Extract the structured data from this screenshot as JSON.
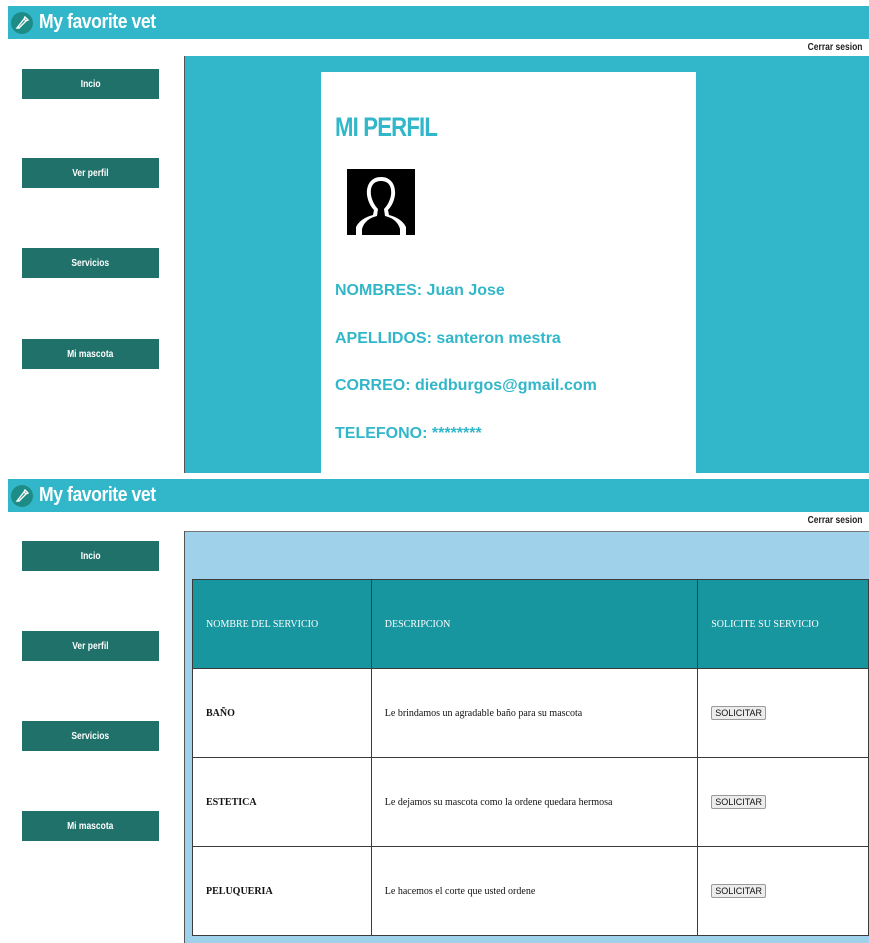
{
  "app": {
    "brand_title": "My favorite vet",
    "logout_label": "Cerrar sesion",
    "nav": [
      "Incio",
      "Ver perfil",
      "Servicios",
      "Mi mascota"
    ]
  },
  "profile_screen": {
    "title": "MI PERFIL",
    "fields": {
      "nombres": "NOMBRES: Juan Jose",
      "apellidos": "APELLIDOS: santeron mestra",
      "correo": "CORREO: diedburgos@gmail.com",
      "telefono": "TELEFONO: ********"
    }
  },
  "services_screen": {
    "columns": [
      "NOMBRE DEL SERVICIO",
      "DESCRIPCION",
      "SOLICITE SU SERVICIO"
    ],
    "rows": [
      {
        "name": "BAÑO",
        "description": "Le brindamos un agradable baño para su mascota",
        "action": "SOLICITAR"
      },
      {
        "name": "ESTETICA",
        "description": "Le dejamos su mascota como la ordene quedara hermosa",
        "action": "SOLICITAR"
      },
      {
        "name": "PELUQUERIA",
        "description": "Le hacemos el corte que usted ordene",
        "action": "SOLICITAR"
      }
    ]
  },
  "colors": {
    "header": "#31b7c9",
    "nav_button": "#1f716a",
    "table_header": "#1796a0",
    "services_background": "#9fd1ea"
  },
  "icons": {
    "logo": "pen-nib-icon",
    "avatar": "user-silhouette-icon"
  }
}
